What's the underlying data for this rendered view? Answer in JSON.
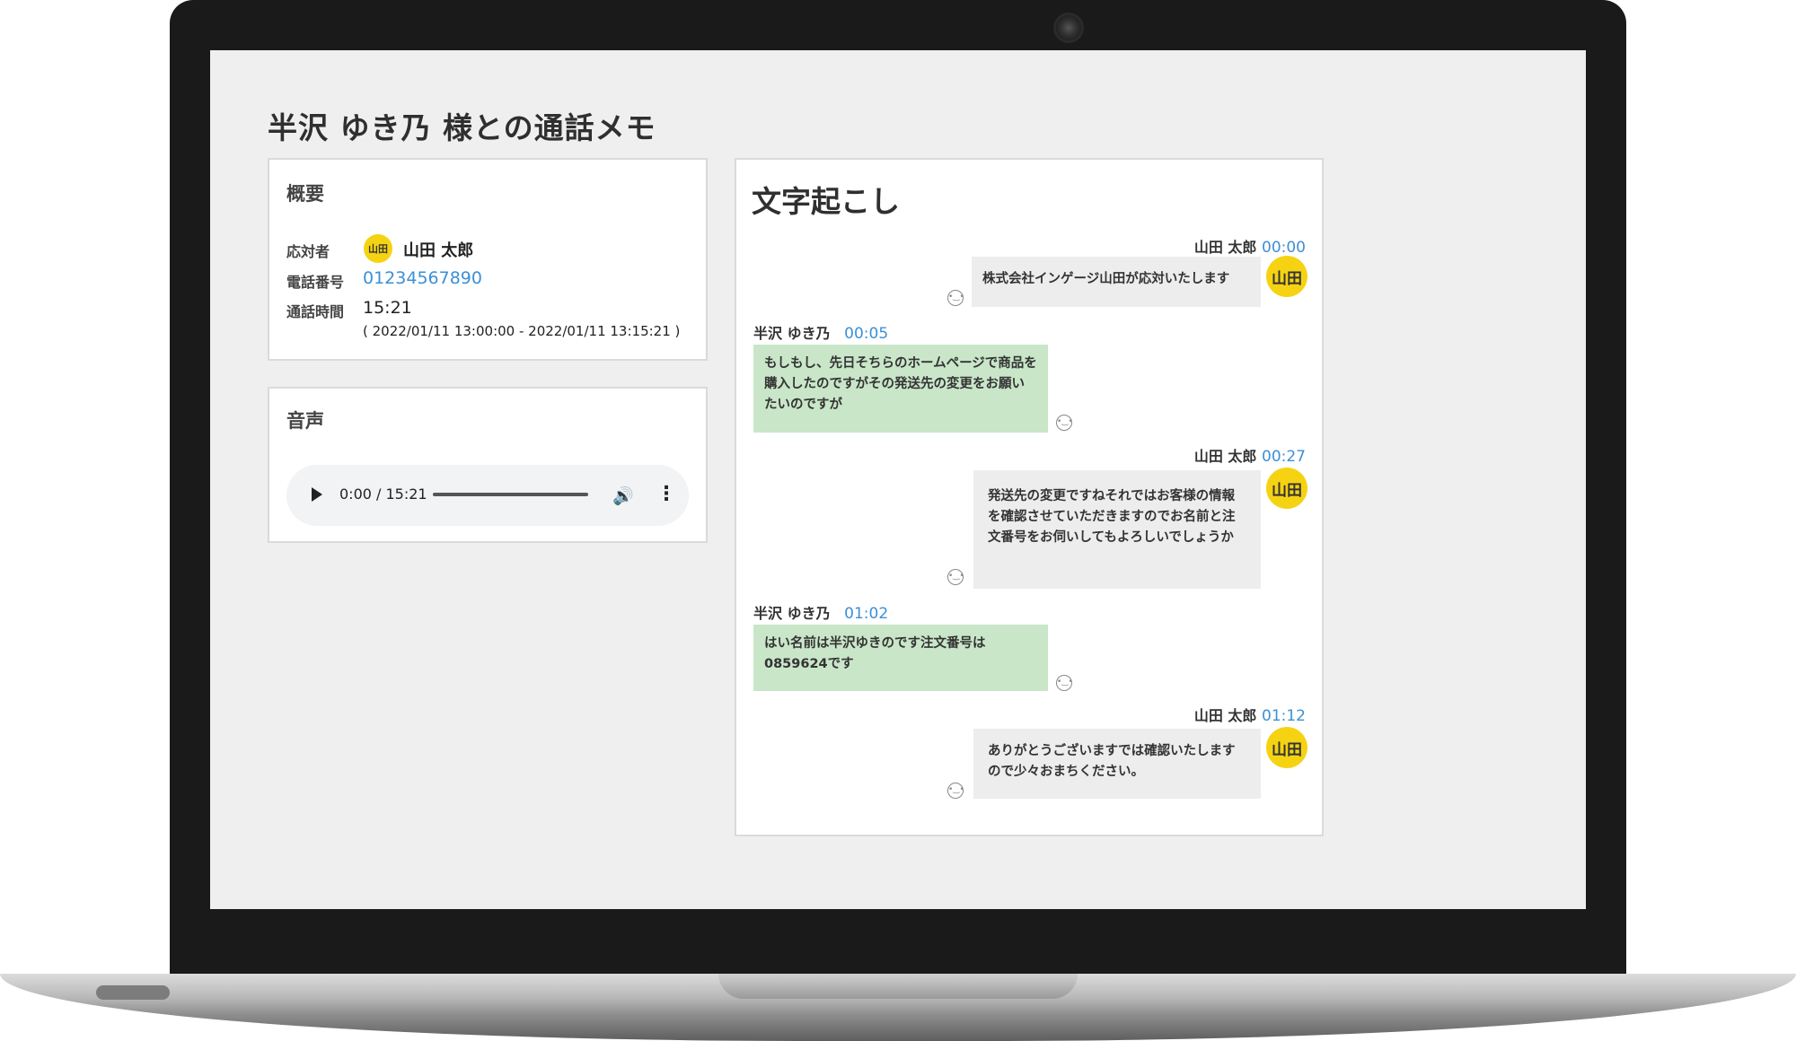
{
  "page": {
    "title": "半沢 ゆき乃 様との通話メモ"
  },
  "summary": {
    "title": "概要",
    "responder_label": "応対者",
    "responder_avatar": "山田",
    "responder_name": "山田 太郎",
    "phone_label": "電話番号",
    "phone": "01234567890",
    "duration_label": "通話時間",
    "duration": "15:21",
    "range": "( 2022/01/11 13:00:00 - 2022/01/11 13:15:21 )"
  },
  "audio": {
    "title": "音声",
    "time": "0:00 / 15:21",
    "progress": 0
  },
  "transcript": {
    "title": "文字起こし",
    "messages": [
      {
        "speaker": "山田 太郎",
        "time": "00:00",
        "avatar": "山田",
        "text": "株式会社インゲージ山田が応対いたします",
        "role": "operator"
      },
      {
        "speaker": "半沢 ゆき乃",
        "time": "00:05",
        "text": "もしもし、先日そちらのホームページで商品を購入したのですがその発送先の変更をお願いたいのですが",
        "role": "customer"
      },
      {
        "speaker": "山田 太郎",
        "time": "00:27",
        "avatar": "山田",
        "text": "発送先の変更ですねそれではお客様の情報を確認させていただきますのでお名前と注文番号をお伺いしてもよろしいでしょうか",
        "role": "operator"
      },
      {
        "speaker": "半沢 ゆき乃",
        "time": "01:02",
        "text": "はい名前は半沢ゆきのです注文番号は0859624です",
        "role": "customer"
      },
      {
        "speaker": "山田 太郎",
        "time": "01:12",
        "avatar": "山田",
        "text": "ありがとうございますでは確認いたしますので少々おまちください。",
        "role": "operator"
      }
    ]
  },
  "colors": {
    "accent": "#3d8fd6",
    "avatar": "#f5d313",
    "customer_bubble": "#c9e6c9",
    "operator_bubble": "#ededed"
  },
  "icons": [
    "play-icon",
    "volume-icon",
    "more-vert-icon",
    "sentiment-neutral-icon",
    "camera-icon"
  ]
}
